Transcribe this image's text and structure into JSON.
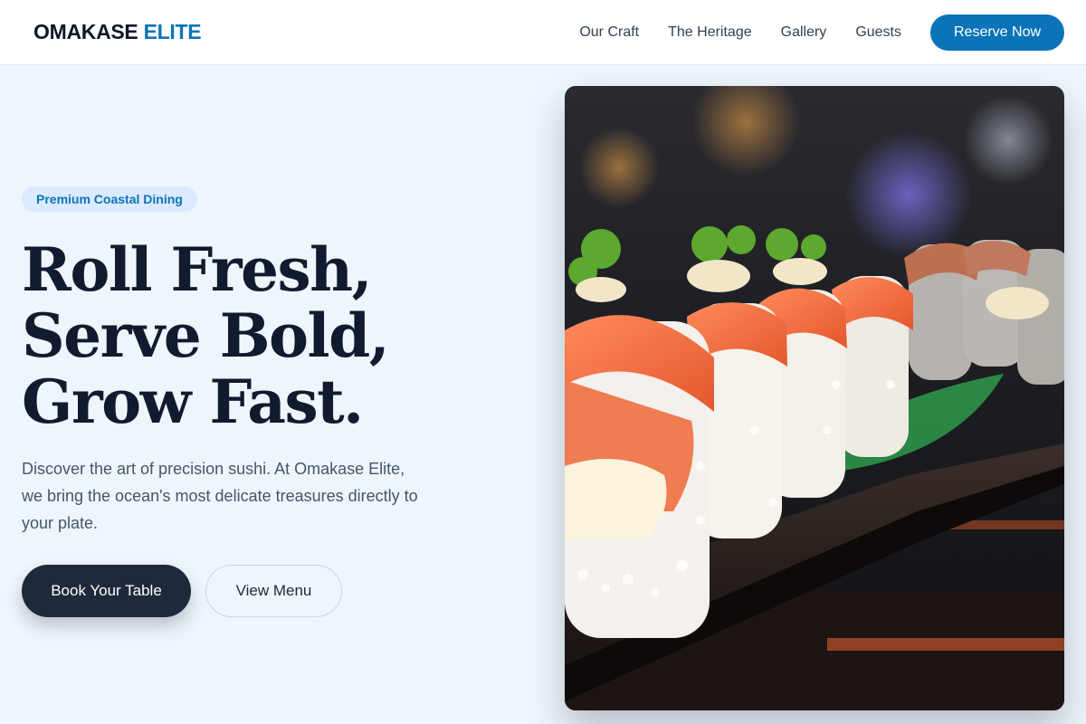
{
  "brand": {
    "name": "OMAKASE",
    "accent": "ELITE"
  },
  "nav": {
    "links": [
      "Our Craft",
      "The Heritage",
      "Gallery",
      "Guests"
    ],
    "cta": "Reserve Now"
  },
  "hero": {
    "badge": "Premium Coastal Dining",
    "headline": [
      "Roll Fresh,",
      "Serve Bold,",
      "Grow Fast."
    ],
    "description": "Discover the art of precision sushi. At Omakase Elite, we bring the ocean's most delicate treasures directly to your plate.",
    "primary_cta": "Book Your Table",
    "secondary_cta": "View Menu"
  },
  "colors": {
    "accent": "#0b74b8",
    "dark": "#1e293b",
    "background": "#eef6fc",
    "badge_bg": "#dbeafe"
  }
}
